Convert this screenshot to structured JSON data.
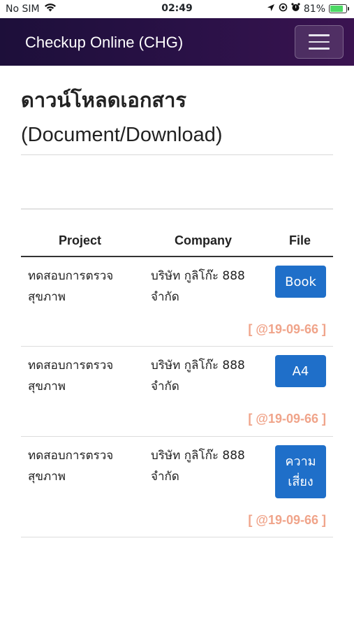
{
  "status_bar": {
    "carrier": "No SIM",
    "time": "02:49",
    "battery": "81%",
    "battery_level": 0.81,
    "wifi_icon": "wifi-icon",
    "location_icon": "location-arrow-icon",
    "alarm_icon": "alarm-clock-icon"
  },
  "navbar": {
    "brand": "Checkup Online (CHG)",
    "menu_icon": "hamburger-menu-icon",
    "bg_color": "#24103f"
  },
  "page": {
    "title_th": "ดาวน์โหลดเอกสาร",
    "title_en": "(Document/Download)"
  },
  "table": {
    "headers": [
      "Project",
      "Company",
      "File"
    ],
    "rows": [
      {
        "project": "ทดสอบการตรวจสุขภาพ",
        "company": "บริษัท กูลิโก๊ะ 888 จำกัด",
        "file": "Book",
        "date": "[ @19-09-66 ]"
      },
      {
        "project": "ทดสอบการตรวจสุขภาพ",
        "company": "บริษัท กูลิโก๊ะ 888 จำกัด",
        "file": "A4",
        "date": "[ @19-09-66 ]"
      },
      {
        "project": "ทดสอบการตรวจสุขภาพ",
        "company": "บริษัท กูลิโก๊ะ 888 จำกัด",
        "file": "ความเสี่ยง",
        "date": "[ @19-09-66 ]"
      }
    ]
  },
  "colors": {
    "button": "#1f6fc9",
    "date_text": "#f0a48a"
  }
}
